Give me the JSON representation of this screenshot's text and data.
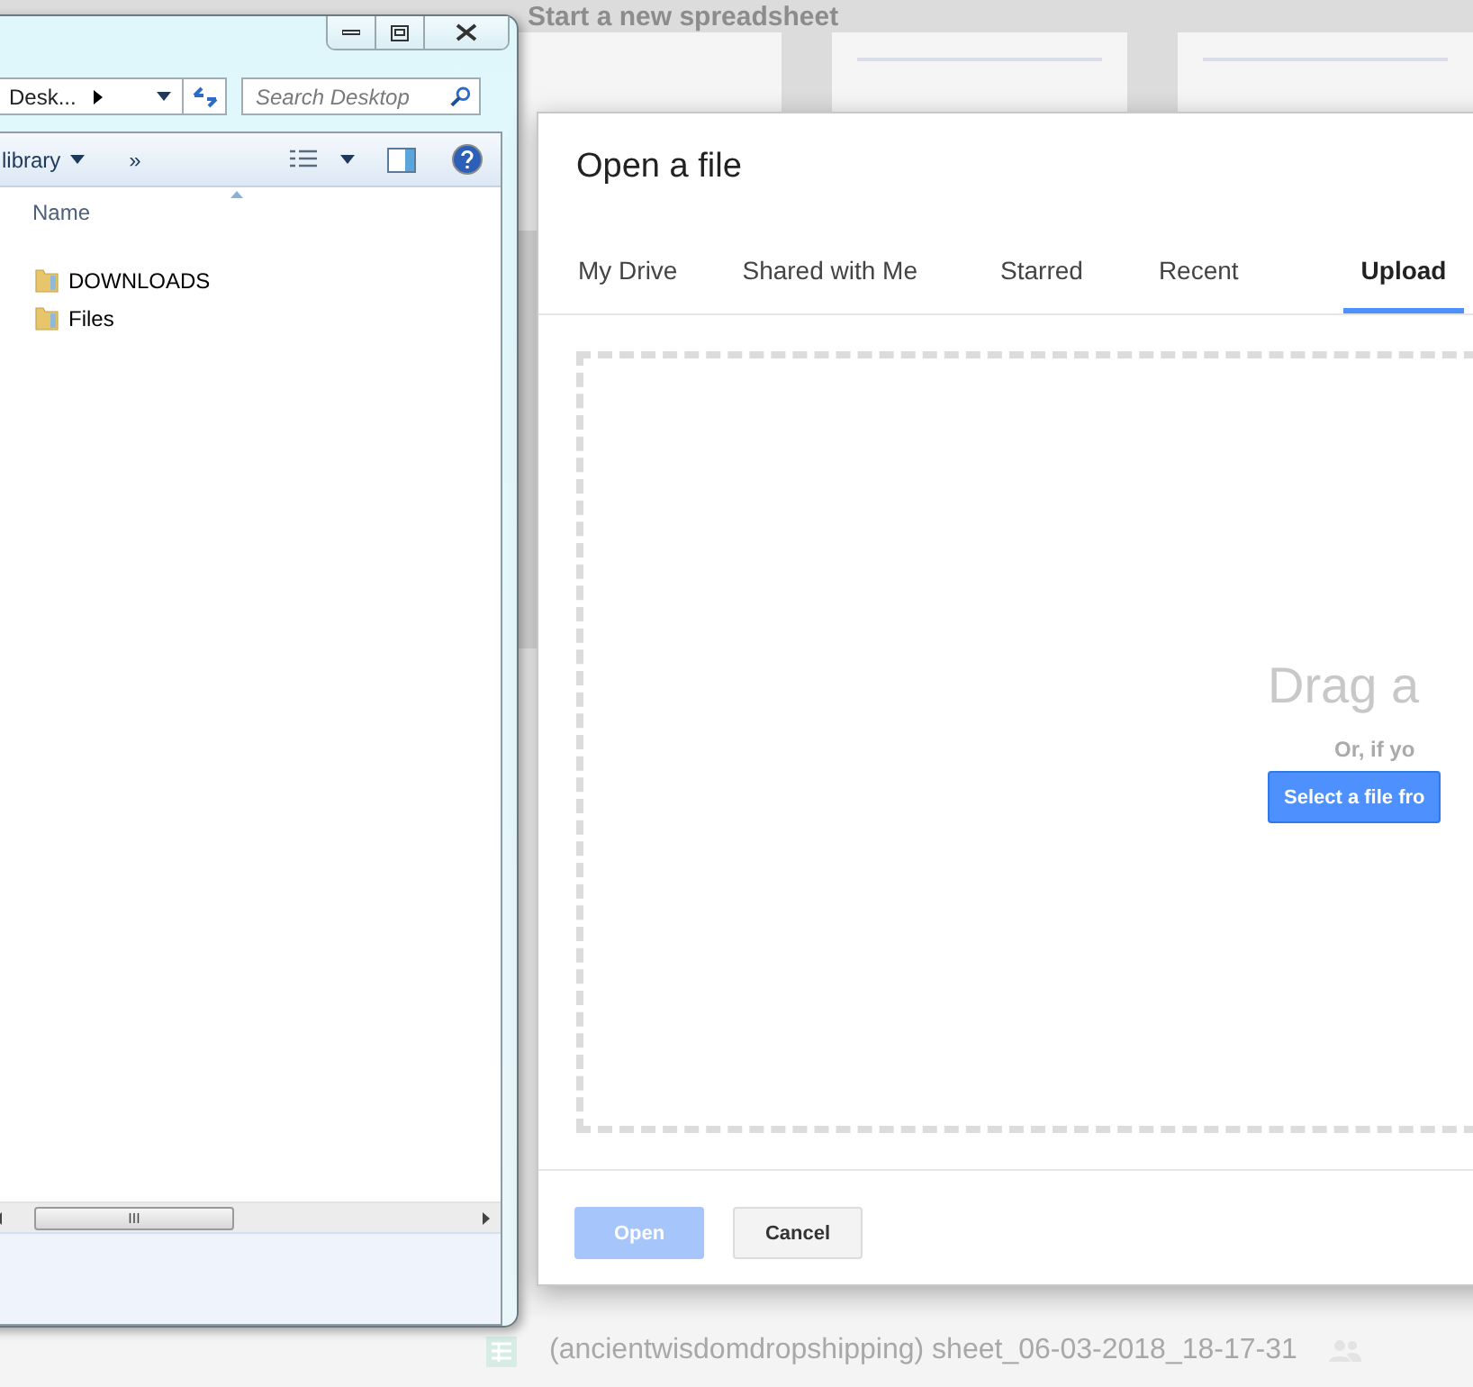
{
  "background": {
    "heading": "Start a new spreadsheet",
    "recent_file": {
      "name": "(ancientwisdomdropshipping) sheet_06-03-2018_18-17-31"
    }
  },
  "explorer": {
    "address": "Desk...",
    "search": {
      "placeholder": "Search Desktop"
    },
    "toolbar": {
      "menu": "library",
      "overflow": "»"
    },
    "columns": [
      "Name"
    ],
    "files": [
      {
        "name": "DOWNLOADS"
      },
      {
        "name": "Files"
      }
    ],
    "scrollbar_grip": "III"
  },
  "dialog": {
    "title": "Open a file",
    "tabs": [
      {
        "label": "My Drive",
        "selected": false
      },
      {
        "label": "Shared with Me",
        "selected": false
      },
      {
        "label": "Starred",
        "selected": false
      },
      {
        "label": "Recent",
        "selected": false
      },
      {
        "label": "Upload",
        "selected": true
      }
    ],
    "drop": {
      "heading": "Drag a",
      "hint": "Or, if yo",
      "button": "Select a file fro"
    },
    "buttons": [
      {
        "label": "Open",
        "disabled": true
      },
      {
        "label": "Cancel",
        "disabled": false
      }
    ]
  }
}
